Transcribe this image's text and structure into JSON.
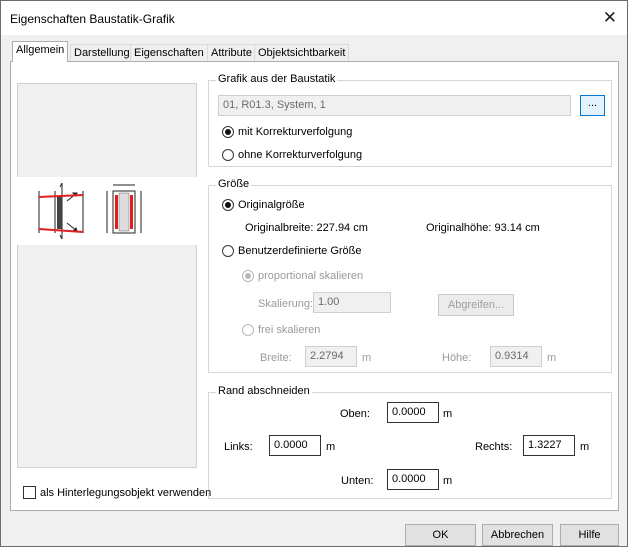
{
  "window": {
    "title": "Eigenschaften Baustatik-Grafik"
  },
  "tabs": [
    {
      "label": "Allgemein"
    },
    {
      "label": "Darstellung"
    },
    {
      "label": "Eigenschaften"
    },
    {
      "label": "Attribute"
    },
    {
      "label": "Objektsichtbarkeit"
    }
  ],
  "grafik": {
    "legend": "Grafik aus der Baustatik",
    "source_value": "01, R01.3, System, 1",
    "browse_label": "...",
    "mit_label": "mit Korrekturverfolgung",
    "ohne_label": "ohne Korrekturverfolgung"
  },
  "groesse": {
    "legend": "Größe",
    "original_label": "Originalgröße",
    "breite_text": "Originalbreite: 227.94 cm",
    "hoehe_text": "Originalhöhe:  93.14 cm",
    "benutzer_label": "Benutzerdefinierte Größe",
    "proportional_label": "proportional skalieren",
    "skalierung_label": "Skalierung:",
    "skalierung_value": "1.00",
    "abgreifen_label": "Abgreifen...",
    "frei_label": "frei skalieren",
    "breite_label": "Breite:",
    "breite_value": "2.2794",
    "breite_unit": "m",
    "hoehe_label": "Höhe:",
    "hoehe_value": "0.9314",
    "hoehe_unit": "m"
  },
  "rand": {
    "legend": "Rand abschneiden",
    "oben_label": "Oben:",
    "oben_value": "0.0000",
    "links_label": "Links:",
    "links_value": "0.0000",
    "rechts_label": "Rechts:",
    "rechts_value": "1.3227",
    "unten_label": "Unten:",
    "unten_value": "0.0000",
    "unit": "m"
  },
  "hinterlegung_label": "als Hinterlegungsobjekt verwenden",
  "buttons": {
    "ok": "OK",
    "abbrechen": "Abbrechen",
    "hilfe": "Hilfe"
  },
  "colors": {
    "accent": "#0078d7",
    "section_red": "#e02020"
  }
}
